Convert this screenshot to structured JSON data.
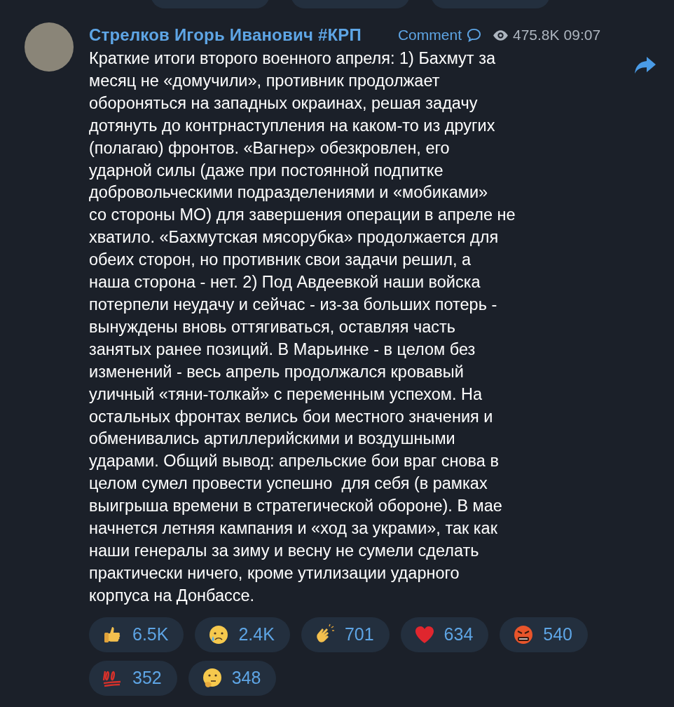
{
  "previous_reactions": [
    {
      "kind": "pill"
    },
    {
      "kind": "pill"
    },
    {
      "kind": "pill"
    }
  ],
  "post": {
    "author": "Стрелков Игорь Иванович #КРП",
    "comment_label": "Comment",
    "views": "475.8K",
    "time": "09:07",
    "text": "Краткие итоги второго военного апреля: 1) Бахмут за\nмесяц не «домучили», противник продолжает\nобороняться на западных окраинах, решая задачу\nдотянуть до контрнаступления на каком-то из других\n(полагаю) фронтов. «Вагнер» обезкровлен, его\nударной силы (даже при постоянной подпитке\nдобровольческими подразделениями и «мобиками»\nсо стороны МО) для завершения операции в апреле не\nхватило. «Бахмутская мясорубка» продолжается для\nобеих сторон, но противник свои задачи решил, а\nнаша сторона - нет. 2) Под Авдеевкой наши войска\nпотерпели неудачу и сейчас - из-за больших потерь -\nвынуждены вновь оттягиваться, оставляя часть\nзанятых ранее позиций. В Марьинке - в целом без\nизменений - весь апрель продолжался кровавый\nуличный «тяни-толкай» с переменным успехом. На\nостальных фронтах велись бои местного значения и\nобменивались артиллерийскими и воздушными\nударами. Общий вывод: апрельские бои враг снова в\nцелом сумел провести успешно  для себя (в рамках\nвыигрыша времени в стратегической обороне). В мае\nначнется летняя кампания и «ход за украми», так как\nнаши генералы за зиму и весну не сумели сделать\nпрактически ничего, кроме утилизации ударного\nкорпуса на Донбассе.",
    "reactions": [
      {
        "kind": "thumbs_up",
        "count": "6.5K"
      },
      {
        "kind": "crying",
        "count": "2.4K"
      },
      {
        "kind": "clapping",
        "count": "701"
      },
      {
        "kind": "heart",
        "count": "634"
      },
      {
        "kind": "cursing",
        "count": "540"
      },
      {
        "kind": "hundred",
        "count": "352"
      },
      {
        "kind": "thinking",
        "count": "348"
      }
    ]
  }
}
